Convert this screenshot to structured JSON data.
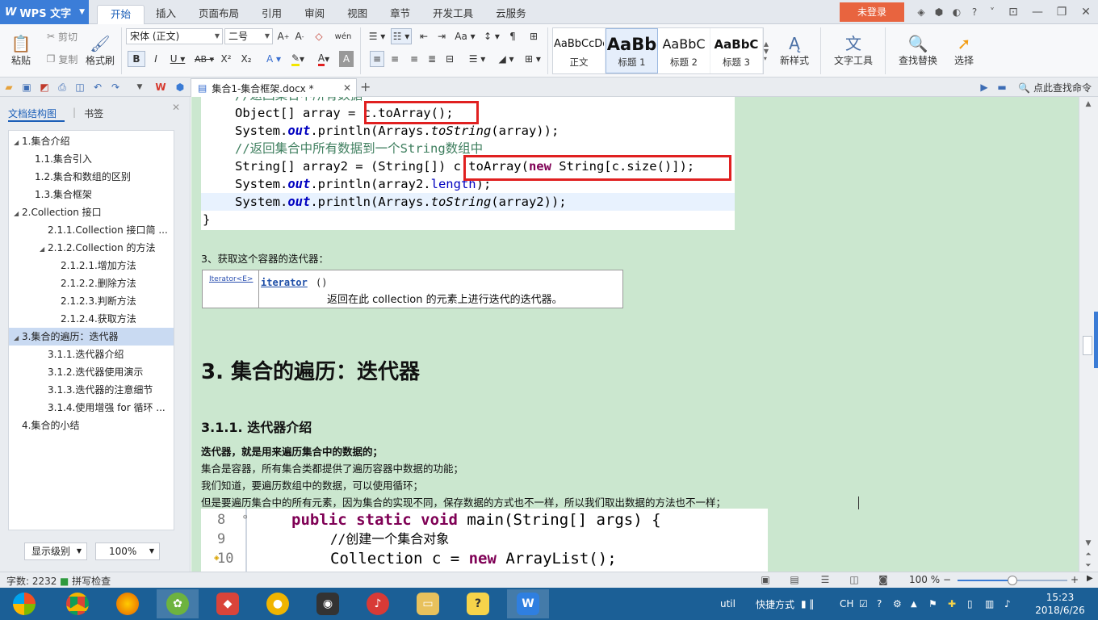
{
  "menubar": {
    "app_name": "WPS 文字",
    "tabs": [
      "开始",
      "插入",
      "页面布局",
      "引用",
      "审阅",
      "视图",
      "章节",
      "开发工具",
      "云服务"
    ],
    "login": "未登录"
  },
  "ribbon": {
    "paste": "粘贴",
    "cut": "剪切",
    "copy": "复制",
    "format_painter": "格式刷",
    "font_name": "宋体 (正文)",
    "font_size": "二号",
    "styles": [
      {
        "sample": "AaBbCcDd",
        "name": "正文"
      },
      {
        "sample": "AaBb",
        "name": "标题 1"
      },
      {
        "sample": "AaBbC",
        "name": "标题 2"
      },
      {
        "sample": "AaBbC",
        "name": "标题 3"
      }
    ],
    "new_style": "新样式",
    "text_tools": "文字工具",
    "find_replace": "查找替换",
    "select": "选择"
  },
  "tabbar": {
    "doc_title": "集合1-集合框架.docx *",
    "search_cmd": "点此查找命令"
  },
  "nav": {
    "tab_outline": "文档结构图",
    "tab_bookmark": "书签",
    "items": [
      {
        "label": "1.集合介绍",
        "level": 0,
        "toggle": "◢"
      },
      {
        "label": "1.1.集合引入",
        "level": 1,
        "toggle": ""
      },
      {
        "label": "1.2.集合和数组的区别",
        "level": 1,
        "toggle": ""
      },
      {
        "label": "1.3.集合框架",
        "level": 1,
        "toggle": ""
      },
      {
        "label": "2.Collection 接口",
        "level": 0,
        "toggle": "◢"
      },
      {
        "label": "2.1.1.Collection 接口简 ...",
        "level": 2,
        "toggle": ""
      },
      {
        "label": "2.1.2.Collection 的方法",
        "level": 2,
        "toggle": "◢"
      },
      {
        "label": "2.1.2.1.增加方法",
        "level": 3,
        "toggle": ""
      },
      {
        "label": "2.1.2.2.删除方法",
        "level": 3,
        "toggle": ""
      },
      {
        "label": "2.1.2.3.判断方法",
        "level": 3,
        "toggle": ""
      },
      {
        "label": "2.1.2.4.获取方法",
        "level": 3,
        "toggle": ""
      },
      {
        "label": "3.集合的遍历：迭代器",
        "level": 0,
        "toggle": "◢"
      },
      {
        "label": "3.1.1.迭代器介绍",
        "level": 2,
        "toggle": ""
      },
      {
        "label": "3.1.2.迭代器使用演示",
        "level": 2,
        "toggle": ""
      },
      {
        "label": "3.1.3.迭代器的注意细节",
        "level": 2,
        "toggle": ""
      },
      {
        "label": "3.1.4.使用增强 for 循环 ...",
        "level": 2,
        "toggle": ""
      },
      {
        "label": "4.集合的小结",
        "level": 0,
        "toggle": ""
      }
    ],
    "selected_index": 11,
    "display_level": "显示级别",
    "zoom": "100%"
  },
  "doc": {
    "top_comment_partial": "//返回集合中所有数据",
    "code": {
      "l1_type": "Object[] array = ",
      "l1_call": "c.toArray();",
      "l2_a": "System.",
      "l2_out": "out",
      "l2_b": ".println(Arrays.",
      "l2_ts": "toString",
      "l2_c": "(array));",
      "l3_comment": "//返回集合中所有数据到一个String数组中",
      "l4_a": "String[] array2 = (String[]) ",
      "l4_call_a": "c.toArray(",
      "l4_new": "new",
      "l4_call_b": " String[c.size()]);",
      "l5_a": "System.",
      "l5_out": "out",
      "l5_b": ".println(array2.",
      "l5_len": "length",
      "l5_c": ");",
      "l6_a": "System.",
      "l6_out": "out",
      "l6_b": ".println(Arrays.",
      "l6_ts": "toString",
      "l6_c": "(array2));",
      "l7": "}"
    },
    "step3": "3、获取这个容器的迭代器：",
    "api": {
      "return_type": "Iterator<E>",
      "method": "iterator",
      "method_tail": "()",
      "desc": "返回在此 collection 的元素上进行迭代的迭代器。"
    },
    "heading": "3. 集合的遍历：迭代器",
    "subheading": "3.1.1. 迭代器介绍",
    "para_bold": "迭代器，就是用来遍历集合中的数据的；",
    "para1": "集合是容器，所有集合类都提供了遍历容器中数据的功能；",
    "para2": "我们知道，要遍历数组中的数据，可以使用循环；",
    "para3": "但是要遍历集合中的所有元素，因为集合的实现不同，保存数据的方式也不一样，所以我们取出数据的方法也不一样；",
    "code2": {
      "ln8": "8",
      "ln9": "9",
      "ln10": "10",
      "l8_kw": "public static void",
      "l8_rest": " main(String[] args) {",
      "l9": "//创建一个集合对象",
      "l10_a": "Collection c = ",
      "l10_new": "new",
      "l10_b": " ArrayList();"
    }
  },
  "status": {
    "word_count": "字数: 2232",
    "spell_check": "拼写检查",
    "zoom": "100 %",
    "zoom_level": 0.5
  },
  "taskbar": {
    "tray_text1": "util",
    "tray_text2": "快捷方式",
    "ime": "CH",
    "time": "15:23",
    "date": "2018/6/26"
  },
  "colors": {
    "accent": "#1c5fb8",
    "doc_bg": "#cbe7cf",
    "taskbar": "#1b5f96",
    "highlight_box": "#e02020",
    "login": "#e8643f"
  }
}
